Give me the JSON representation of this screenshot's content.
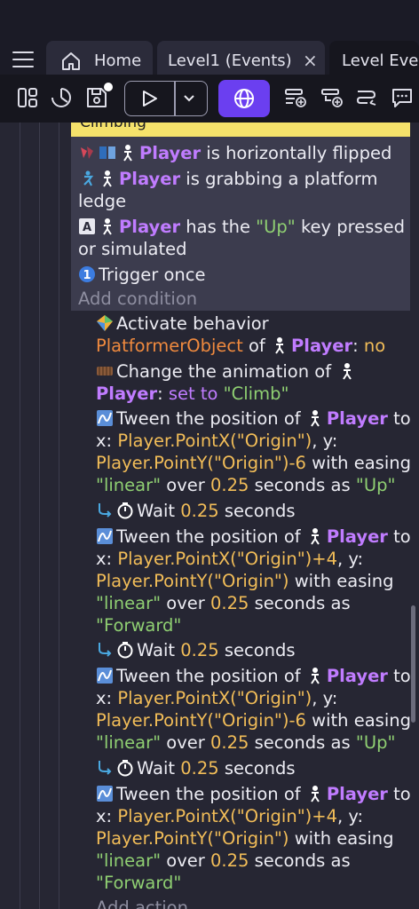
{
  "tabs": [
    {
      "label": "Home",
      "icon": "home-icon"
    },
    {
      "label": "Level1 (Events)",
      "close": "×"
    },
    {
      "label": "Level Ever",
      "active": true
    }
  ],
  "event": {
    "title": "Climbing",
    "conditions": [
      {
        "parts": [
          "Player",
          " is horizontally flipped"
        ]
      },
      {
        "parts": [
          "Player",
          " is grabbing a platform",
          "ledge"
        ]
      },
      {
        "parts": [
          "Player",
          " has the ",
          "\"Up\"",
          " key pressed",
          "or simulated"
        ]
      },
      {
        "parts": [
          "Trigger once"
        ]
      }
    ],
    "add_condition": "Add condition",
    "actions": [
      {
        "parts": [
          "Activate behavior",
          "PlatformerObject",
          " of ",
          "Player",
          ": ",
          "no"
        ]
      },
      {
        "parts": [
          "Change the animation of",
          "Player",
          ": ",
          "set to",
          " ",
          "\"Climb\""
        ]
      },
      {
        "parts": [
          "Tween the position of ",
          "Player",
          " to",
          "x: ",
          "Player.PointX(\"Origin\")",
          ", y:",
          "Player.PointY(\"Origin\")-6",
          " with easing",
          "\"linear\"",
          " over ",
          "0.25",
          " seconds as ",
          "\"Up\""
        ]
      },
      {
        "parts": [
          "Wait ",
          "0.25",
          " seconds"
        ]
      },
      {
        "parts": [
          "Tween the position of ",
          "Player",
          " to",
          "x: ",
          "Player.PointX(\"Origin\")+4",
          ", y:",
          "Player.PointY(\"Origin\")",
          " with easing",
          "\"linear\"",
          " over ",
          "0.25",
          " seconds as",
          "\"Forward\""
        ]
      },
      {
        "parts": [
          "Wait ",
          "0.25",
          " seconds"
        ]
      },
      {
        "parts": [
          "Tween the position of ",
          "Player",
          " to",
          "x: ",
          "Player.PointX(\"Origin\")",
          ", y:",
          "Player.PointY(\"Origin\")-6",
          " with easing",
          "\"linear\"",
          " over ",
          "0.25",
          " seconds as ",
          "\"Up\""
        ]
      },
      {
        "parts": [
          "Wait ",
          "0.25",
          " seconds"
        ]
      },
      {
        "parts": [
          "Tween the position of ",
          "Player",
          " to",
          "x: ",
          "Player.PointX(\"Origin\")+4",
          ", y:",
          "Player.PointY(\"Origin\")",
          " with easing",
          "\"linear\"",
          " over ",
          "0.25",
          " seconds as",
          "\"Forward\""
        ]
      }
    ],
    "add_action": "Add action"
  },
  "colors": {
    "object": "#c07cff",
    "string": "#8fcf72",
    "number": "#f2bd58",
    "behavior": "#f08a3e",
    "preview_button": "#6b3ff0",
    "event_title_bg": "#f5e26b"
  }
}
